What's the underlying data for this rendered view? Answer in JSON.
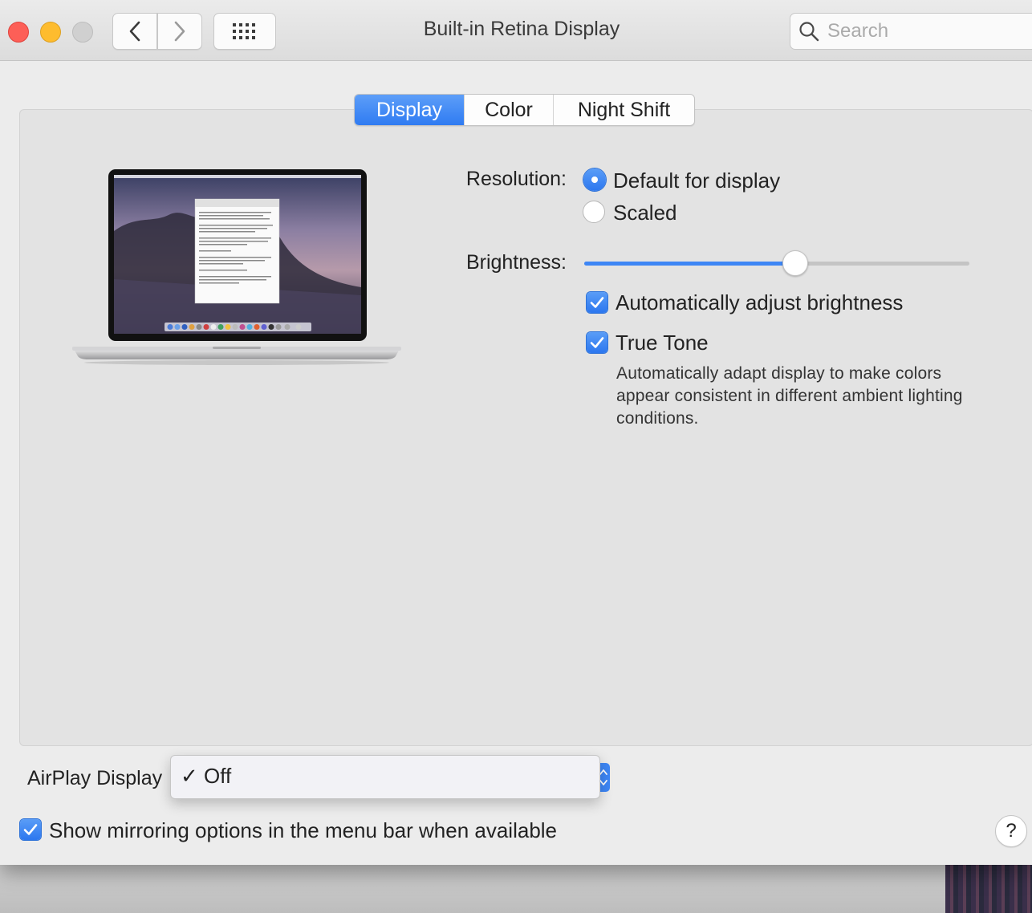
{
  "window": {
    "title": "Built-in Retina Display",
    "search_placeholder": "Search"
  },
  "tabs": [
    {
      "label": "Display",
      "selected": true
    },
    {
      "label": "Color",
      "selected": false
    },
    {
      "label": "Night Shift",
      "selected": false
    }
  ],
  "resolution": {
    "label": "Resolution:",
    "options": [
      {
        "label": "Default for display",
        "selected": true
      },
      {
        "label": "Scaled",
        "selected": false
      }
    ]
  },
  "brightness": {
    "label": "Brightness:",
    "level": 0.545
  },
  "auto_brightness": {
    "label": "Automatically adjust brightness",
    "checked": true
  },
  "true_tone": {
    "label": "True Tone",
    "checked": true,
    "description": "Automatically adapt display to make colors appear consistent in different ambient lighting conditions."
  },
  "airplay": {
    "label": "AirPlay Display",
    "menu_item": "✓ Off"
  },
  "mirroring": {
    "label": "Show mirroring options in the menu bar when available",
    "checked": true
  },
  "help": {
    "label": "?"
  },
  "colors": {
    "accent": "#3d86f5",
    "close": "#fd5f57",
    "minimize": "#febc2e"
  }
}
